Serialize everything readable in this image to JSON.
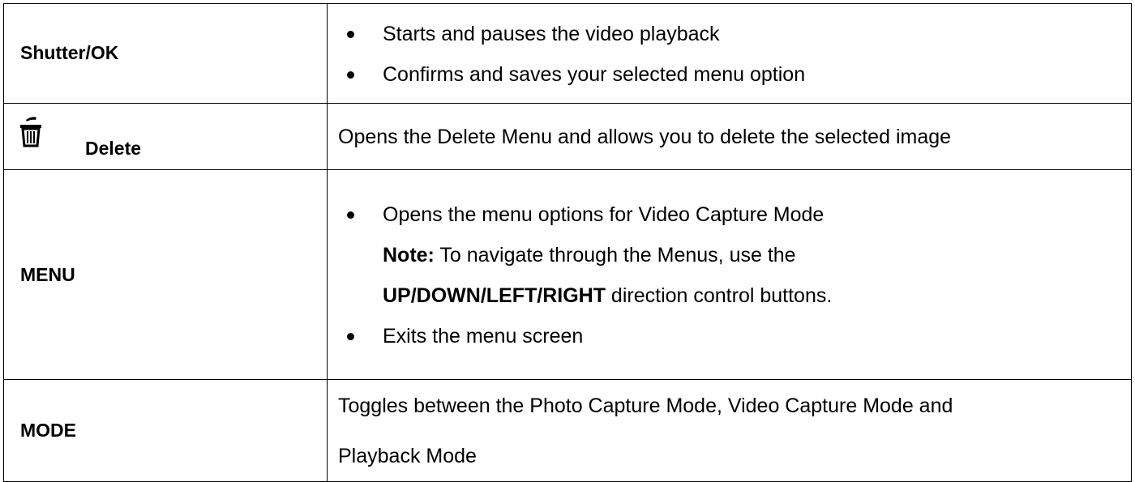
{
  "rows": [
    {
      "button": "Shutter/OK",
      "bullets": [
        "Starts and pauses the video playback",
        "Confirms and saves your selected menu option"
      ]
    },
    {
      "button": "Delete",
      "icon": "trash-can-icon",
      "description": "Opens the Delete Menu and allows you to delete the selected image"
    },
    {
      "button": "MENU",
      "bullet_1": "Opens the menu options for Video Capture Mode",
      "note_label": "Note:",
      "note_text": " To navigate through the Menus, use the",
      "note_directions": "UP/DOWN/LEFT/RIGHT",
      "note_suffix": " direction control buttons.",
      "bullet_2": "Exits the menu screen"
    },
    {
      "button": "MODE",
      "description_line_1": "Toggles between the Photo Capture Mode, Video Capture Mode and",
      "description_line_2": "Playback Mode"
    }
  ]
}
